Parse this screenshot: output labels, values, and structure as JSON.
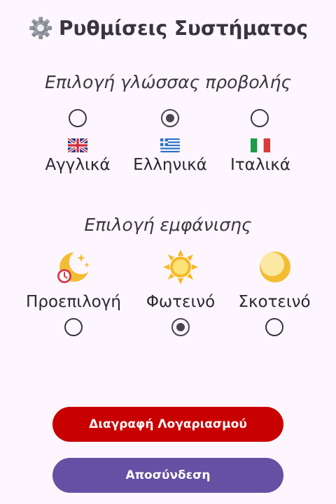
{
  "header": {
    "title": "Ρυθμίσεις Συστήματος",
    "icon": "gear-icon"
  },
  "language_section": {
    "heading": "Επιλογή γλώσσας προβολής",
    "selected": "Ελληνικά",
    "options": [
      {
        "label": "Αγγλικά",
        "flag": "uk-flag-icon",
        "checked": false
      },
      {
        "label": "Ελληνικά",
        "flag": "greece-flag-icon",
        "checked": true
      },
      {
        "label": "Ιταλικά",
        "flag": "italy-flag-icon",
        "checked": false
      }
    ]
  },
  "theme_section": {
    "heading": "Επιλογή εμφάνισης",
    "selected": "Φωτεινό",
    "options": [
      {
        "label": "Προεπιλογή",
        "icon": "moon-stars-clock-icon",
        "checked": false
      },
      {
        "label": "Φωτεινό",
        "icon": "sun-icon",
        "checked": true
      },
      {
        "label": "Σκοτεινό",
        "icon": "crescent-moon-icon",
        "checked": false
      }
    ]
  },
  "actions": {
    "delete_account": "Διαγραφή Λογαριασμού",
    "logout": "Αποσύνδεση"
  },
  "colors": {
    "background": "#fdf6fe",
    "delete_button": "#c90000",
    "logout_button": "#6650a4",
    "sun": "#f5b921",
    "moon": "#f3bd33",
    "clock": "#d9364d"
  }
}
